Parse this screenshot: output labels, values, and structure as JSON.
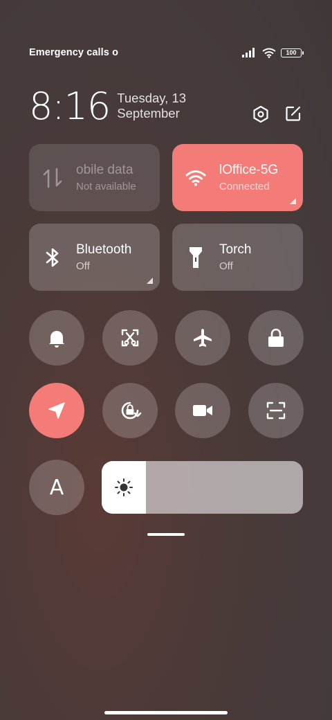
{
  "status_bar": {
    "carrier": "Emergency calls o",
    "battery": "100"
  },
  "header": {
    "time": "8:16",
    "date": "Tuesday, 13 September"
  },
  "tiles": {
    "mobile_data": {
      "title": "obile data",
      "subtitle": "Not available"
    },
    "wifi": {
      "title": "lOffice-5G",
      "subtitle": "Connected"
    },
    "bluetooth": {
      "title": "Bluetooth",
      "subtitle": "Off"
    },
    "torch": {
      "title": "Torch",
      "subtitle": "Off"
    }
  },
  "toggles": [
    "bell-icon",
    "screenshot-crop-icon",
    "airplane-icon",
    "lock-icon",
    "location-icon",
    "rotation-lock-icon",
    "video-camera-icon",
    "scan-icon"
  ],
  "reading_mode": {
    "letter": "A"
  },
  "brightness": {
    "level": 0.22
  },
  "colors": {
    "accent": "#f37c78"
  }
}
